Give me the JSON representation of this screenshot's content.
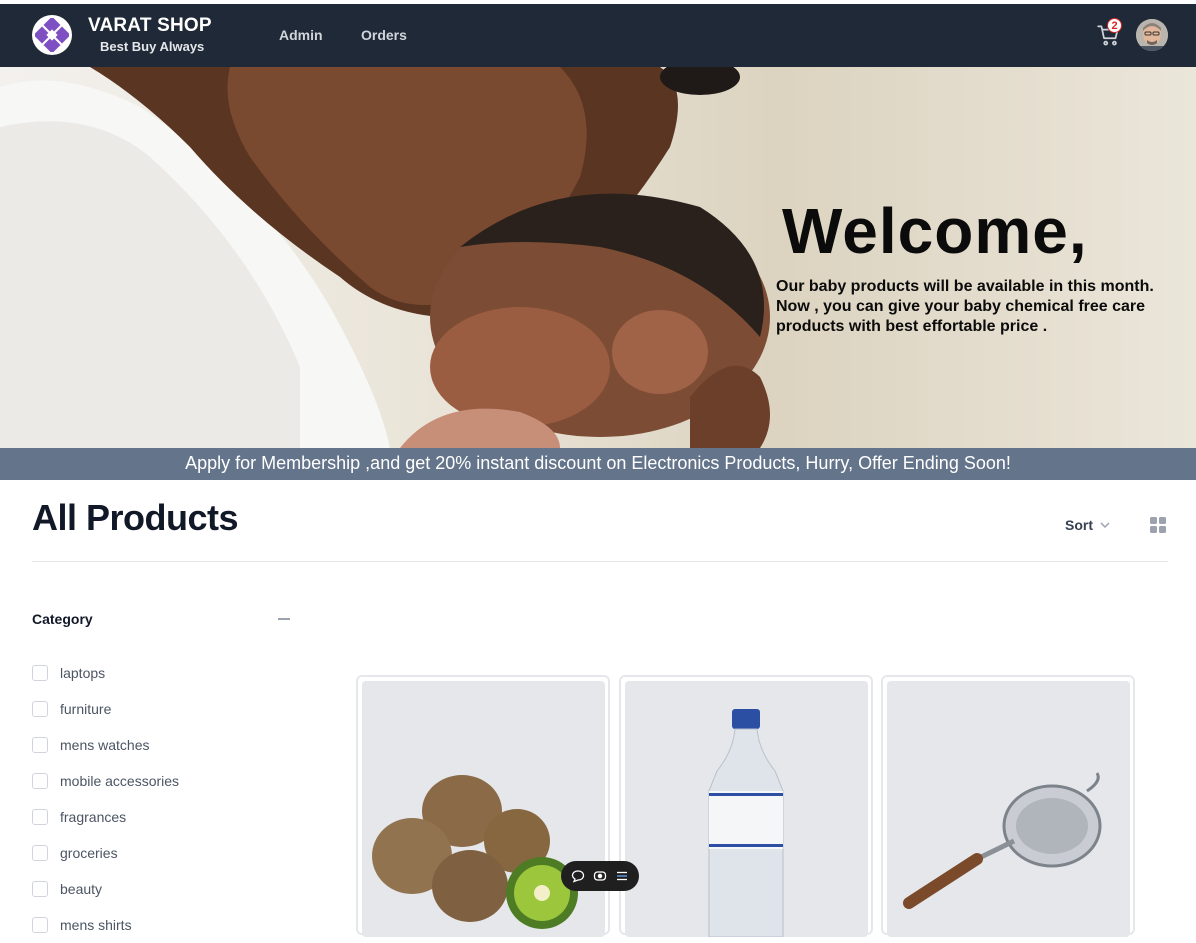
{
  "brand": {
    "name": "VARAT SHOP",
    "tagline": "Best Buy Always"
  },
  "nav": {
    "links": [
      {
        "label": "Admin"
      },
      {
        "label": "Orders"
      }
    ],
    "cart_count": "2"
  },
  "hero": {
    "title": "Welcome,",
    "line1": "Our baby products will be available in this month.",
    "line2": "Now , you can give your baby chemical free care",
    "line3": "products with best effortable price ."
  },
  "promo": {
    "text": "Apply for Membership ,and get 20% instant discount on Electronics Products, Hurry, Offer Ending Soon!"
  },
  "page": {
    "title": "All Products",
    "sort_label": "Sort"
  },
  "filters": {
    "title": "Category",
    "options": [
      {
        "label": "laptops",
        "checked": false
      },
      {
        "label": "furniture",
        "checked": false
      },
      {
        "label": "mens watches",
        "checked": false
      },
      {
        "label": "mobile accessories",
        "checked": false
      },
      {
        "label": "fragrances",
        "checked": false
      },
      {
        "label": "groceries",
        "checked": false
      },
      {
        "label": "beauty",
        "checked": false
      },
      {
        "label": "mens shirts",
        "checked": false
      }
    ]
  },
  "products": [
    {
      "image": "kiwi-image"
    },
    {
      "image": "water-bottle-image"
    },
    {
      "image": "strainer-image"
    }
  ],
  "colors": {
    "navbar": "#1f2937",
    "promo": "#64748b",
    "brand_logo_accent": "#7e4fc2"
  }
}
